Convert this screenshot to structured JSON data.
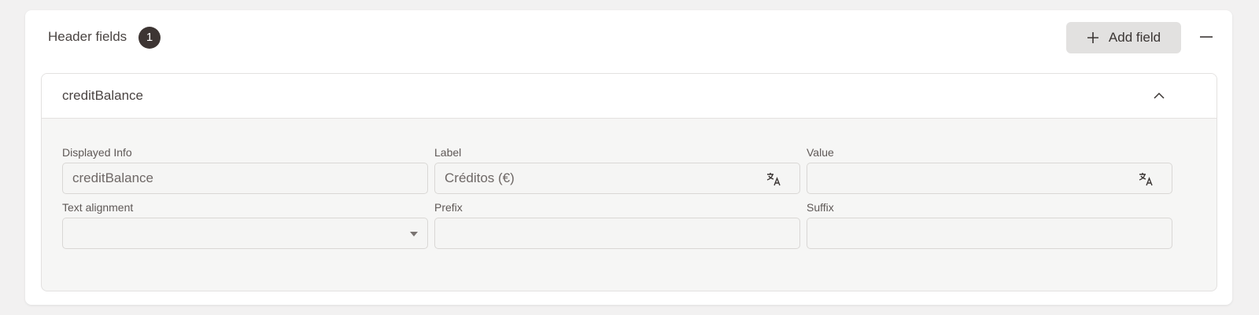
{
  "header": {
    "title": "Header fields",
    "count": "1",
    "add_button_label": "Add field",
    "icons": {
      "add": "plus-icon",
      "collapse": "minus-icon"
    }
  },
  "field_panel": {
    "title": "creditBalance",
    "toggle_icon": "chevron-up-icon",
    "fields": {
      "displayed_info": {
        "label": "Displayed Info",
        "value": "creditBalance"
      },
      "label": {
        "label": "Label",
        "value": "Créditos (€)",
        "icon": "translate-icon"
      },
      "value": {
        "label": "Value",
        "value": "",
        "icon": "translate-icon"
      },
      "text_alignment": {
        "label": "Text alignment",
        "value": "",
        "icon": "caret-down-icon"
      },
      "prefix": {
        "label": "Prefix",
        "value": ""
      },
      "suffix": {
        "label": "Suffix",
        "value": ""
      }
    }
  },
  "colors": {
    "page_bg": "#f2f1f1",
    "badge_bg": "#3d3533",
    "button_bg": "#e2e1e0",
    "input_bg": "#f5f5f4"
  }
}
